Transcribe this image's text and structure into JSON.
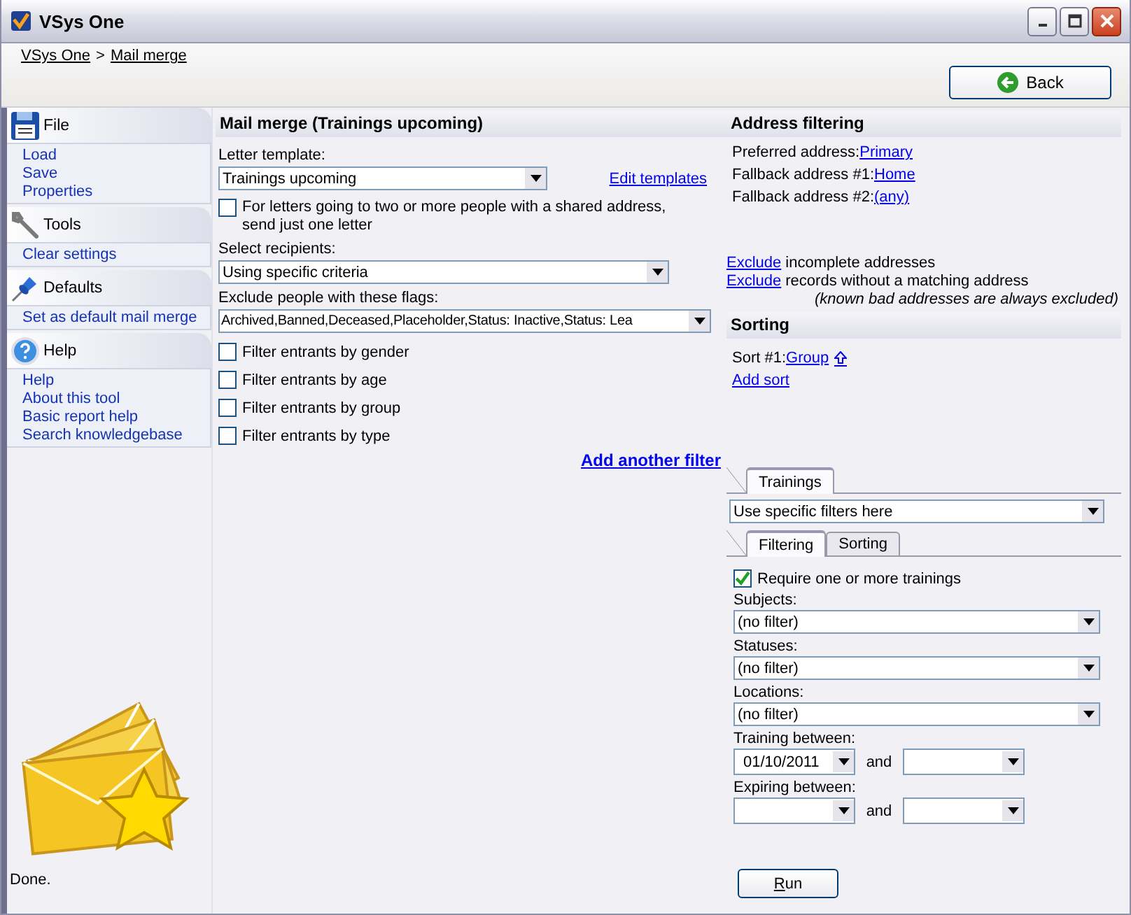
{
  "window": {
    "title": "VSys One"
  },
  "breadcrumb": {
    "items": [
      {
        "label": "VSys One"
      },
      {
        "label": "Mail merge"
      }
    ],
    "separator": ">"
  },
  "back_button": {
    "label": "Back"
  },
  "sidebar": {
    "groups": [
      {
        "title": "File",
        "kind": "file",
        "items": [
          "Load",
          "Save",
          "Properties"
        ]
      },
      {
        "title": "Tools",
        "kind": "tools",
        "items": [
          "Clear settings"
        ]
      },
      {
        "title": "Defaults",
        "kind": "defaults",
        "items": [
          "Set as default mail merge"
        ]
      },
      {
        "title": "Help",
        "kind": "help",
        "items": [
          "Help",
          "About this tool",
          "Basic report help",
          "Search knowledgebase"
        ]
      }
    ]
  },
  "status": "Done.",
  "main": {
    "title": "Mail merge (Trainings upcoming)",
    "letter_template": {
      "label": "Letter template:",
      "value": "Trainings upcoming"
    },
    "edit_templates": "Edit templates",
    "shared_address": {
      "label": "For letters going to two or more people with a shared address, send just one letter",
      "checked": false
    },
    "recipients": {
      "label": "Select recipients:",
      "value": "Using specific criteria"
    },
    "exclude_flags": {
      "label": "Exclude people with these flags:",
      "value": "Archived,Banned,Deceased,Placeholder,Status: Inactive,Status: Lea"
    },
    "filters": [
      {
        "label": "Filter entrants by gender",
        "checked": false
      },
      {
        "label": "Filter entrants by age",
        "checked": false
      },
      {
        "label": "Filter entrants by group",
        "checked": false
      },
      {
        "label": "Filter entrants by type",
        "checked": false
      }
    ],
    "add_filter": "Add another filter"
  },
  "address_filtering": {
    "title": "Address filtering",
    "rows": [
      {
        "label": "Preferred address:",
        "value": "Primary"
      },
      {
        "label": "Fallback address #1:",
        "value": "Home"
      },
      {
        "label": "Fallback address #2:",
        "value": "(any)"
      }
    ],
    "excludes": [
      {
        "link": "Exclude",
        "text": "incomplete addresses"
      },
      {
        "link": "Exclude",
        "text": "records without a matching address"
      }
    ],
    "note": "(known bad addresses are always excluded)"
  },
  "sorting": {
    "title": "Sorting",
    "sorts": [
      {
        "label": "Sort #1:",
        "value": "Group"
      }
    ],
    "add_sort": "Add sort"
  },
  "trainings": {
    "tabs": [
      {
        "label": "Trainings",
        "selected": true
      }
    ],
    "mode": "Use specific filters here",
    "subtabs": [
      {
        "label": "Filtering",
        "selected": true
      },
      {
        "label": "Sorting",
        "selected": false
      }
    ],
    "require": {
      "label": "Require one or more trainings",
      "checked": true
    },
    "selects": [
      {
        "label": "Subjects:",
        "value": "(no filter)"
      },
      {
        "label": "Statuses:",
        "value": "(no filter)"
      },
      {
        "label": "Locations:",
        "value": "(no filter)"
      }
    ],
    "ranges": [
      {
        "label": "Training between:",
        "from": "01/10/2011",
        "joiner": "and"
      },
      {
        "label": "Expiring between:",
        "joiner": "and"
      }
    ]
  },
  "run_button": "Run"
}
